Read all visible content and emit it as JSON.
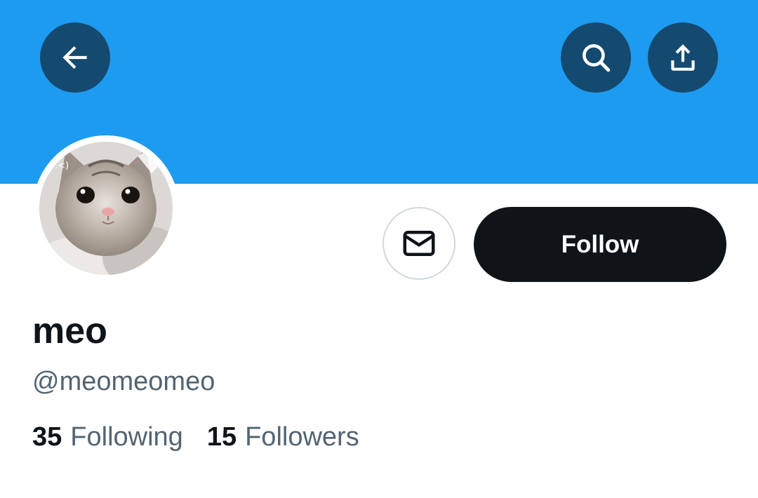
{
  "colors": {
    "banner": "#1d9bf0",
    "overlay_button": "rgba(15,20,25,0.6)",
    "follow_button": "#0f1419",
    "primary_text": "#0f1419",
    "secondary_text": "#536471",
    "border": "#cfd9de"
  },
  "header": {
    "back_icon": "arrow-left-icon",
    "search_icon": "search-icon",
    "share_icon": "share-upload-icon"
  },
  "profile": {
    "avatar_overlay_text": "(>.<)",
    "display_name": "meo",
    "handle": "@meomeomeo",
    "following_count": "35",
    "following_label": "Following",
    "followers_count": "15",
    "followers_label": "Followers"
  },
  "actions": {
    "message_icon": "envelope-icon",
    "follow_label": "Follow"
  }
}
